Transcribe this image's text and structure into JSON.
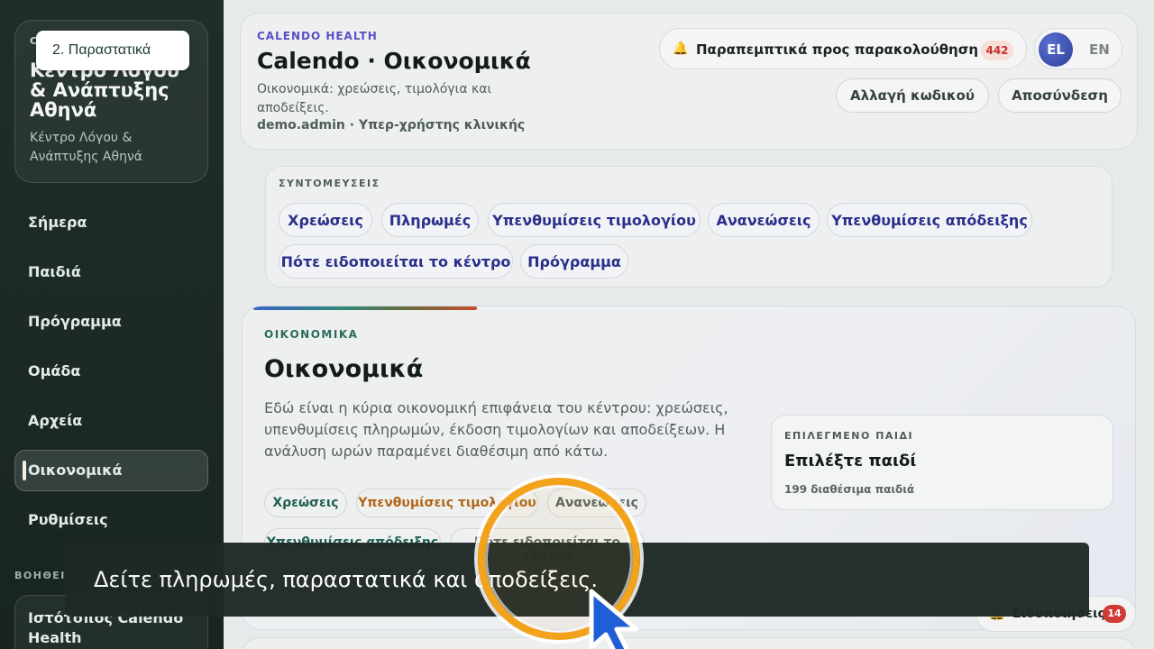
{
  "sidebar": {
    "brand": {
      "eyebrow": "C",
      "name": "Κέντρο Λόγου & Ανάπτυξης Αθηνά",
      "subtitle": "Κέντρο Λόγου & Ανάπτυξης Αθηνά"
    },
    "step_tooltip": "2. Παραστατικά",
    "nav": [
      {
        "label": "Σήμερα",
        "active": false
      },
      {
        "label": "Παιδιά",
        "active": false
      },
      {
        "label": "Πρόγραμμα",
        "active": false
      },
      {
        "label": "Ομάδα",
        "active": false
      },
      {
        "label": "Αρχεία",
        "active": false
      },
      {
        "label": "Οικονομικά",
        "active": true
      },
      {
        "label": "Ρυθμίσεις",
        "active": false
      }
    ],
    "help_label": "ΒΟΗΘΕΙ",
    "help_card": "Ιστότοπος Calendo Health"
  },
  "header": {
    "eyebrow": "CALENDO HEALTH",
    "title": "Calendo · Οικονομικά",
    "subtitle": "Οικονομικά: χρεώσεις, τιμολόγια και αποδείξεις.",
    "user": "demo.admin · Υπερ-χρήστης κλινικής",
    "referrals_label": "Παραπεμπτικά προς παρακολούθηση",
    "referrals_count": "442",
    "lang_el": "EL",
    "lang_en": "EN",
    "change_password": "Αλλαγή κωδικού",
    "logout": "Αποσύνδεση"
  },
  "shortcuts": {
    "label": "ΣΥΝΤΟΜΕΥΣΕΙΣ",
    "items": [
      "Χρεώσεις",
      "Πληρωμές",
      "Υπενθυμίσεις τιμολογίου",
      "Ανανεώσεις",
      "Υπενθυμίσεις απόδειξης",
      "Πότε ειδοποιείται το κέντρο",
      "Πρόγραμμα"
    ]
  },
  "main": {
    "eyebrow": "ΟΙΚΟΝΟΜΙΚΑ",
    "title": "Οικονομικά",
    "description": "Εδώ είναι η κύρια οικονομική επιφάνεια του κέντρου: χρεώσεις, υπενθυμίσεις πληρωμών, έκδοση τιμολογίων και αποδείξεων. Η ανάλυση ωρών παραμένει διαθέσιμη από κάτω.",
    "tags": [
      "Χρεώσεις",
      "Υπενθυμίσεις τιμολογίου",
      "Ανανεώσεις",
      "Υπενθυμίσεις απόδειξης",
      "Πότε ειδοποιείται το κέντρο"
    ],
    "selected_child": {
      "eyebrow": "ΕΠΙΛΕΓΜΕΝΟ ΠΑΙΔΙ",
      "title": "Επιλέξτε παιδί",
      "count": "199 διαθέσιμα παιδιά"
    }
  },
  "notifications": {
    "label": "Ειδοποιήσεις",
    "count": "14"
  },
  "caption": "Δείτε πληρωμές, παραστατικά και αποδείξεις.",
  "colors": {
    "sidebar_bg": "#1f2e2b",
    "accent_purple": "#5b4fc7",
    "highlight_ring": "#f2a21b",
    "cursor_blue": "#1f5fd6",
    "badge_red": "#cf3a37"
  }
}
